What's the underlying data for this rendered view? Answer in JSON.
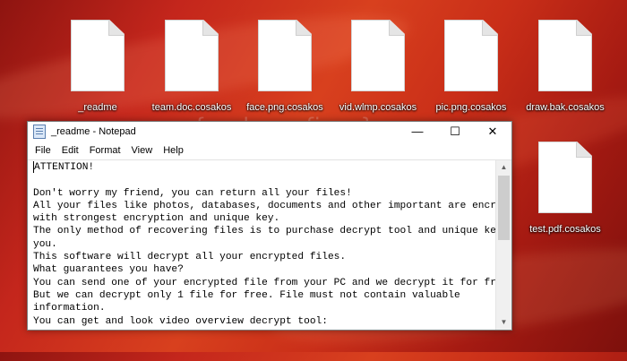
{
  "desktop": {
    "watermark": "{malwarefixes}",
    "icons": [
      {
        "label": "_readme"
      },
      {
        "label": "team.doc.cosakos"
      },
      {
        "label": "face.png.cosakos"
      },
      {
        "label": "vid.wlmp.cosakos"
      },
      {
        "label": "pic.png.cosakos"
      },
      {
        "label": "draw.bak.cosakos"
      },
      {
        "label": "test.pdf.cosakos"
      }
    ]
  },
  "notepad": {
    "title": "_readme - Notepad",
    "controls": {
      "minimize": "—",
      "maximize": "☐",
      "close": "✕"
    },
    "menu": [
      "File",
      "Edit",
      "Format",
      "View",
      "Help"
    ],
    "lines": [
      "ATTENTION!",
      "",
      "Don't worry my friend, you can return all your files!",
      "All your files like photos, databases, documents and other important are encrypted",
      "with strongest encryption and unique key.",
      "The only method of recovering files is to purchase decrypt tool and unique key for",
      "you.",
      "This software will decrypt all your encrypted files.",
      "What guarantees you have?",
      "You can send one of your encrypted file from your PC and we decrypt it for free.",
      "But we can decrypt only 1 file for free. File must not contain valuable",
      "information.",
      "You can get and look video overview decrypt tool:"
    ]
  }
}
